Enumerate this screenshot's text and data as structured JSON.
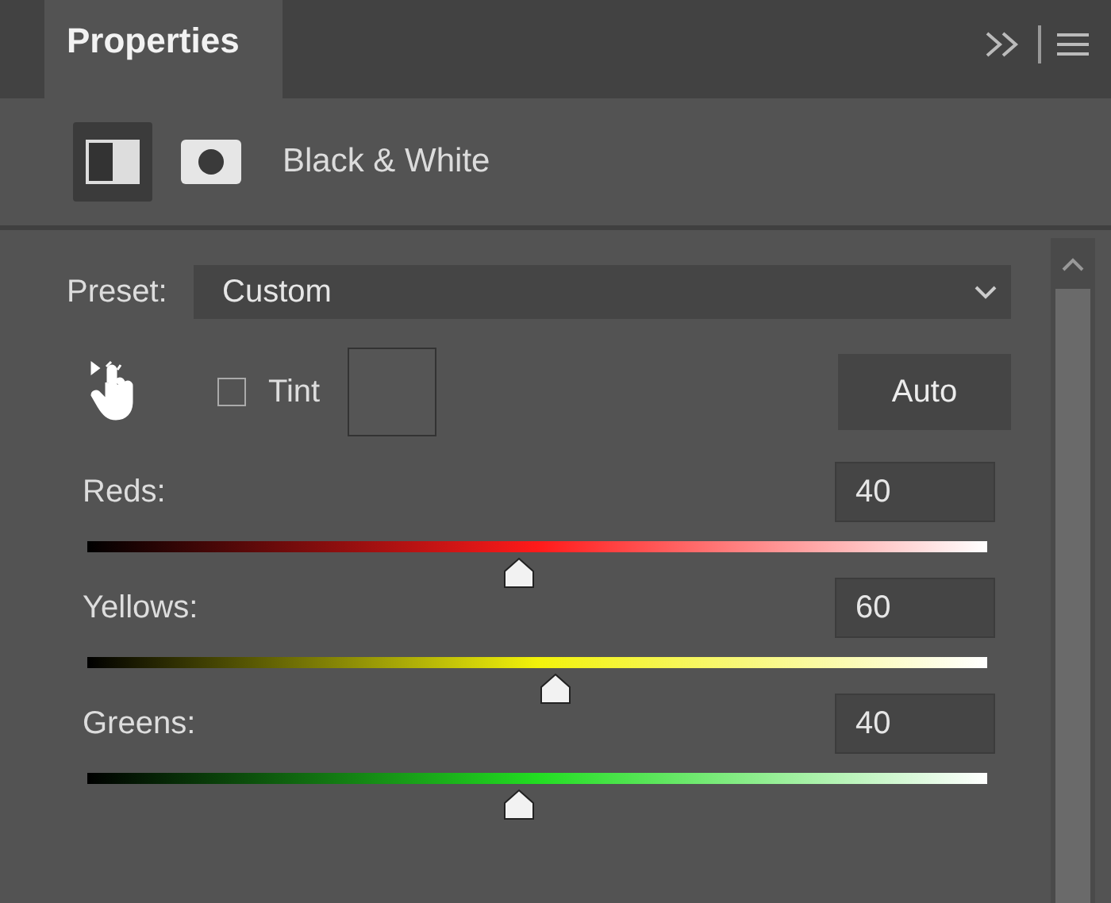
{
  "panel": {
    "tab": "Properties"
  },
  "adjustment": {
    "title": "Black & White",
    "icons": [
      {
        "kind": "adjustment",
        "selected": true
      },
      {
        "kind": "mask",
        "selected": false
      }
    ]
  },
  "preset": {
    "label": "Preset:",
    "value": "Custom"
  },
  "tint": {
    "label": "Tint",
    "checked": false
  },
  "auto_button": "Auto",
  "sliders": [
    {
      "label": "Reds:",
      "value": "40",
      "level": 0.48,
      "color": "#ff1a1a"
    },
    {
      "label": "Yellows:",
      "value": "60",
      "level": 0.52,
      "color": "#f2f20a"
    },
    {
      "label": "Greens:",
      "value": "40",
      "level": 0.48,
      "color": "#22dd22"
    }
  ]
}
